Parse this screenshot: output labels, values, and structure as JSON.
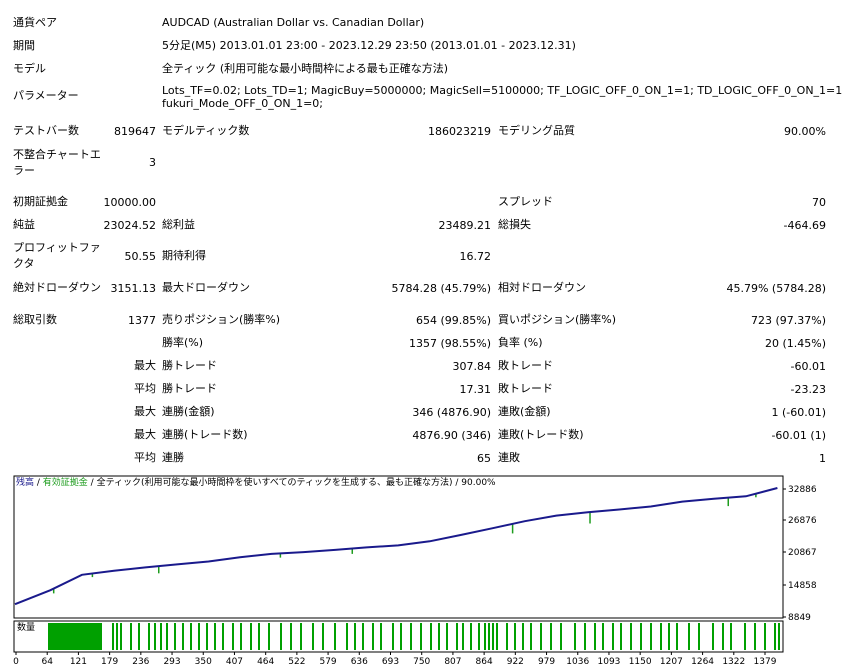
{
  "report": {
    "symbol": {
      "label": "通貨ペア",
      "value": "AUDCAD (Australian Dollar vs. Canadian Dollar)"
    },
    "period": {
      "label": "期間",
      "value": "5分足(M5) 2013.01.01 23:00 - 2023.12.29 23:50 (2013.01.01 - 2023.12.31)"
    },
    "model": {
      "label": "モデル",
      "value": "全ティック (利用可能な最小時間枠による最も正確な方法)"
    },
    "params": {
      "label": "パラメーター",
      "line1": "Lots_TF=0.02; Lots_TD=1; MagicBuy=5000000; MagicSell=5100000; TF_LOGIC_OFF_0_ON_1=1; TD_LOGIC_OFF_0_ON_1=1;",
      "line2": "fukuri_Mode_OFF_0_ON_1=0;"
    },
    "bars": {
      "label": "テストバー数",
      "value": "819647"
    },
    "ticks": {
      "label": "モデルティック数",
      "value": "186023219"
    },
    "quality": {
      "label": "モデリング品質",
      "value": "90.00%"
    },
    "mismatch": {
      "label1": "不整合チャートエ",
      "label2": "ラー",
      "value": "3"
    },
    "deposit": {
      "label": "初期証拠金",
      "value": "10000.00"
    },
    "spread": {
      "label": "スプレッド",
      "value": "70"
    },
    "net_profit": {
      "label": "純益",
      "value": "23024.52"
    },
    "gross_profit": {
      "label": "総利益",
      "value": "23489.21"
    },
    "gross_loss": {
      "label": "総損失",
      "value": "-464.69"
    },
    "profit_factor": {
      "label1": "プロフィットファ",
      "label2": "クタ",
      "value": "50.55"
    },
    "expected_payoff": {
      "label": "期待利得",
      "value": "16.72"
    },
    "abs_dd": {
      "label": "絶対ドローダウン",
      "value": "3151.13"
    },
    "max_dd": {
      "label": "最大ドローダウン",
      "value": "5784.28 (45.79%)"
    },
    "rel_dd": {
      "label": "相対ドローダウン",
      "value": "45.79% (5784.28)"
    },
    "total_trades": {
      "label": "総取引数",
      "value": "1377"
    },
    "short_pos": {
      "label": "売りポジション(勝率%)",
      "value": "654 (99.85%)"
    },
    "long_pos": {
      "label": "買いポジション(勝率%)",
      "value": "723 (97.37%)"
    },
    "win_rate": {
      "label": "勝率(%)",
      "value": "1357 (98.55%)"
    },
    "loss_rate": {
      "label": "負率 (%)",
      "value": "20 (1.45%)"
    },
    "largest_win": {
      "prefix": "最大",
      "label": "勝トレード",
      "value": "307.84"
    },
    "largest_loss": {
      "label": "敗トレード",
      "value": "-60.01"
    },
    "avg_win": {
      "prefix": "平均",
      "label": "勝トレード",
      "value": "17.31"
    },
    "avg_loss": {
      "label": "敗トレード",
      "value": "-23.23"
    },
    "max_consec_win": {
      "prefix": "最大",
      "label": "連勝(金額)",
      "value": "346 (4876.90)"
    },
    "max_consec_loss": {
      "label": "連敗(金額)",
      "value": "1 (-60.01)"
    },
    "max_consec_profit": {
      "prefix": "最大",
      "label": "連勝(トレード数)",
      "value": "4876.90 (346)"
    },
    "max_consec_loss_amt": {
      "label": "連敗(トレード数)",
      "value": "-60.01 (1)"
    },
    "avg_consec_win": {
      "prefix": "平均",
      "label": "連勝",
      "value": "65"
    },
    "avg_consec_loss": {
      "label": "連敗",
      "value": "1"
    }
  },
  "chart_legend": {
    "balance": "残高",
    "sep1": " / ",
    "equity": "有効証拠金",
    "sep2": " / ",
    "model": "全ティック(利用可能な最小時間枠を使いすべてのティックを生成する、最も正確な方法)",
    "sep3": " / ",
    "quality": "90.00%"
  },
  "colors": {
    "balance": "#1a1a8c",
    "equity": "#1e9c1e",
    "volume": "#00a000",
    "frame": "#000000"
  },
  "chart_data": {
    "type": "line",
    "x": [
      0,
      64,
      121,
      179,
      236,
      293,
      350,
      407,
      464,
      522,
      579,
      636,
      693,
      750,
      807,
      864,
      922,
      979,
      1036,
      1093,
      1150,
      1207,
      1264,
      1322,
      1379
    ],
    "series": [
      {
        "name": "残高",
        "values": [
          10000,
          12750,
          15780,
          16570,
          17250,
          17830,
          18400,
          19240,
          19900,
          20250,
          20700,
          21190,
          21580,
          22390,
          23650,
          24970,
          26350,
          27450,
          28100,
          28650,
          29250,
          30200,
          30750,
          31250,
          32886
        ]
      }
    ],
    "yticks": [
      "32886",
      "26876",
      "20867",
      "14858",
      "8849"
    ],
    "xticks": [
      "0",
      "64",
      "121",
      "179",
      "236",
      "293",
      "350",
      "407",
      "464",
      "522",
      "579",
      "636",
      "693",
      "750",
      "807",
      "864",
      "922",
      "979",
      "1036",
      "1093",
      "1150",
      "1207",
      "1264",
      "1322",
      "1379"
    ],
    "ylim": [
      8849,
      32886
    ],
    "xlim": [
      0,
      1380
    ],
    "volume_label": "数量",
    "grid": false
  }
}
